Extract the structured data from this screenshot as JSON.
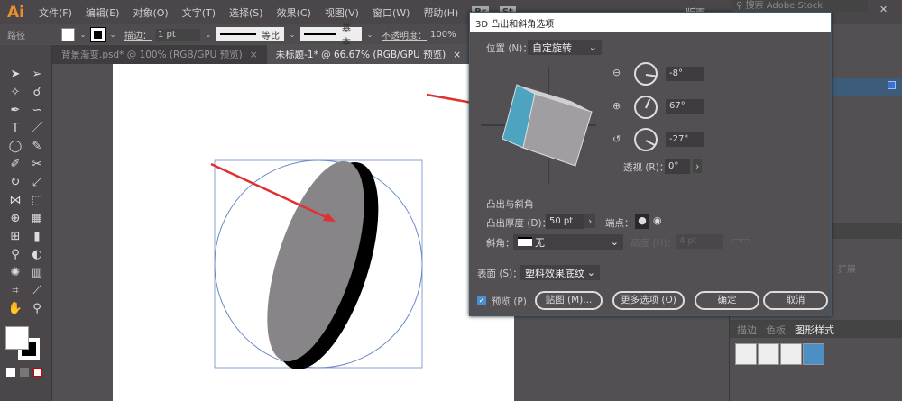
{
  "app": {
    "logo": "Ai",
    "menu": [
      "文件(F)",
      "编辑(E)",
      "对象(O)",
      "文字(T)",
      "选择(S)",
      "效果(C)",
      "视图(V)",
      "窗口(W)",
      "帮助(H)"
    ],
    "bridge": "Br",
    "stock": "St",
    "workspace": "版面",
    "search_placeholder": "搜索 Adobe Stock"
  },
  "control": {
    "object_type": "路径",
    "stroke_label": "描边：",
    "stroke_weight": "1 pt",
    "profile": "等比",
    "brush": "基本",
    "opacity_label": "不透明度：",
    "opacity": "100%"
  },
  "tabs": [
    {
      "label": "背景渐变.psd* @ 100% (RGB/GPU 预览)",
      "close": "×"
    },
    {
      "label": "未标题-1* @ 66.67% (RGB/GPU 预览)",
      "close": "×"
    }
  ],
  "dialog": {
    "title": "3D 凸出和斜角选项",
    "position_label": "位置 (N)：",
    "position_value": "自定旋转",
    "rot_x": "-8°",
    "rot_y": "67°",
    "rot_z": "-27°",
    "perspective_label": "透视 (R)：",
    "perspective": "0°",
    "section": "凸出与斜角",
    "depth_label": "凸出厚度 (D)：",
    "depth": "50 pt",
    "cap_label": "端点：",
    "bevel_label": "斜角：",
    "bevel_value": "无",
    "height_label": "高度 (H)：",
    "height": "4 pt",
    "surface_label": "表面 (S)：",
    "surface_value": "塑料效果底纹",
    "preview_label": "预览 (P)",
    "preview_checked": true,
    "map_btn": "贴图 (M)...",
    "more_btn": "更多选项 (O)",
    "ok_btn": "确定",
    "cancel_btn": "取消"
  },
  "right_panel": {
    "expand": "扩展",
    "tabs": [
      "描边",
      "色板",
      "图形样式"
    ]
  },
  "colors": {
    "accent": "#4da3c0",
    "arrow": "#e03030"
  }
}
